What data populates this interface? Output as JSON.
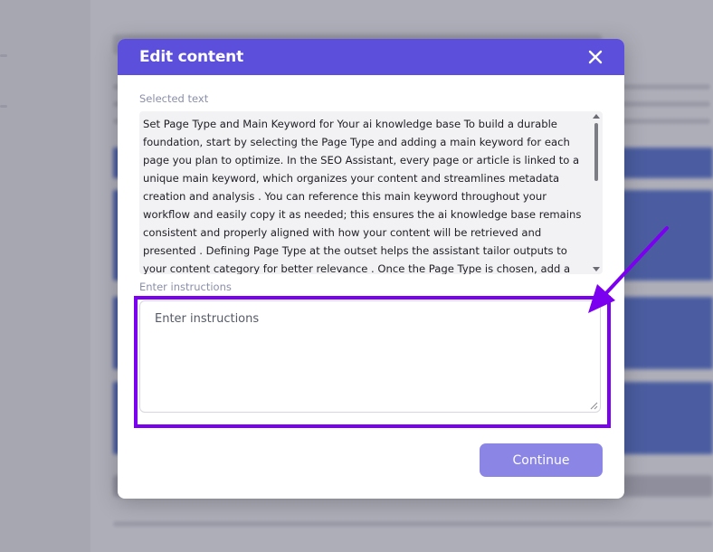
{
  "modal": {
    "title": "Edit content",
    "selected_label": "Selected text",
    "selected_text": "Set Page Type and Main Keyword for Your ai knowledge base To build a durable foundation, start by selecting the Page Type and adding a main keyword for each page you plan to optimize. In the SEO Assistant, every page or article is linked to a unique main keyword, which organizes your content and streamlines metadata creation and analysis . You can reference this main keyword throughout your workflow and easily copy it as needed; this ensures the ai knowledge base remains consistent and properly aligned with how your content will be retrieved and presented . Defining Page Type at the outset helps the assistant tailor outputs to your content category for better relevance . Once the Page Type is chosen, add a main keyword that accurately",
    "instructions_label": "Enter instructions",
    "instructions_placeholder": "Enter instructions",
    "instructions_value": "",
    "continue_label": "Continue"
  },
  "icons": {
    "close": "close-icon",
    "scroll_up": "scroll-up-arrow-icon",
    "scroll_down": "scroll-down-arrow-icon",
    "resize": "resize-handle-icon"
  },
  "colors": {
    "header": "#5b4fdc",
    "continue_button": "#8b86e6",
    "annotation": "#7b00f0",
    "background_highlight": "#3f60c9"
  }
}
